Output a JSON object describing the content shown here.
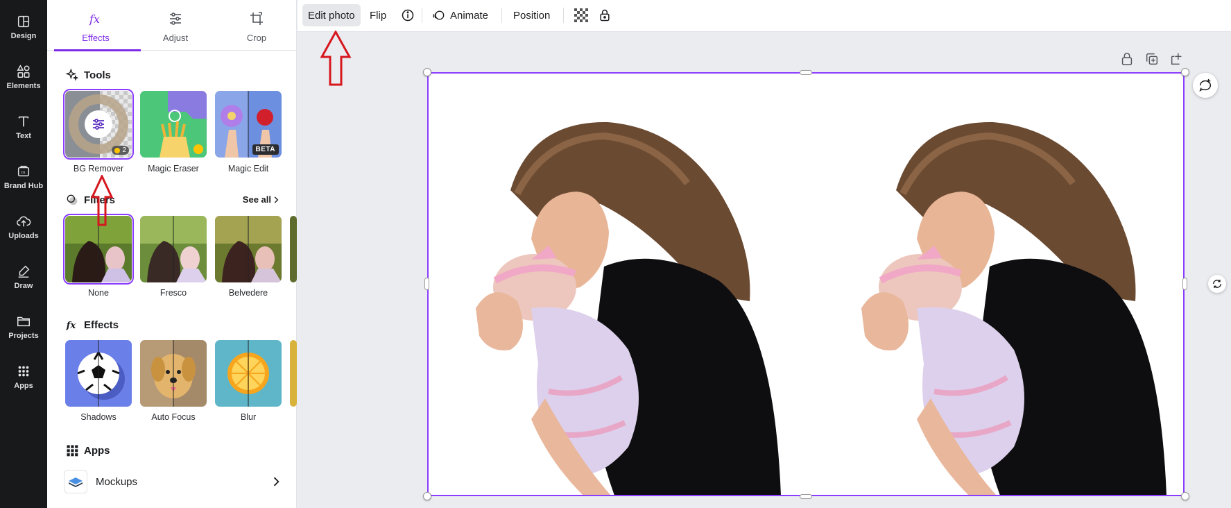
{
  "rail": {
    "items": [
      {
        "label": "Design",
        "icon": "layout-icon"
      },
      {
        "label": "Elements",
        "icon": "shapes-icon"
      },
      {
        "label": "Text",
        "icon": "text-icon"
      },
      {
        "label": "Brand Hub",
        "icon": "brand-icon"
      },
      {
        "label": "Uploads",
        "icon": "cloud-upload-icon"
      },
      {
        "label": "Draw",
        "icon": "pen-icon"
      },
      {
        "label": "Projects",
        "icon": "folder-icon"
      },
      {
        "label": "Apps",
        "icon": "grid-icon"
      }
    ]
  },
  "panel": {
    "tabs": [
      {
        "label": "Effects",
        "icon": "fx-icon",
        "active": true
      },
      {
        "label": "Adjust",
        "icon": "sliders-icon",
        "active": false
      },
      {
        "label": "Crop",
        "icon": "crop-icon",
        "active": false
      }
    ],
    "tools": {
      "heading": "Tools",
      "items": [
        {
          "label": "BG Remover",
          "badge": "2"
        },
        {
          "label": "Magic Eraser",
          "badge": ""
        },
        {
          "label": "Magic Edit",
          "badge": "BETA"
        }
      ]
    },
    "filters": {
      "heading": "Filters",
      "see_all": "See all",
      "items": [
        {
          "label": "None"
        },
        {
          "label": "Fresco"
        },
        {
          "label": "Belvedere"
        }
      ]
    },
    "effects": {
      "heading": "Effects",
      "items": [
        {
          "label": "Shadows"
        },
        {
          "label": "Auto Focus"
        },
        {
          "label": "Blur"
        }
      ]
    },
    "apps": {
      "heading": "Apps",
      "items": [
        {
          "label": "Mockups"
        }
      ]
    }
  },
  "toolbar": {
    "edit_photo": "Edit photo",
    "flip": "Flip",
    "animate": "Animate",
    "position": "Position"
  },
  "colors": {
    "accent": "#8b3dff",
    "rail_bg": "#18191b",
    "annotation_arrow": "#d6171e"
  }
}
